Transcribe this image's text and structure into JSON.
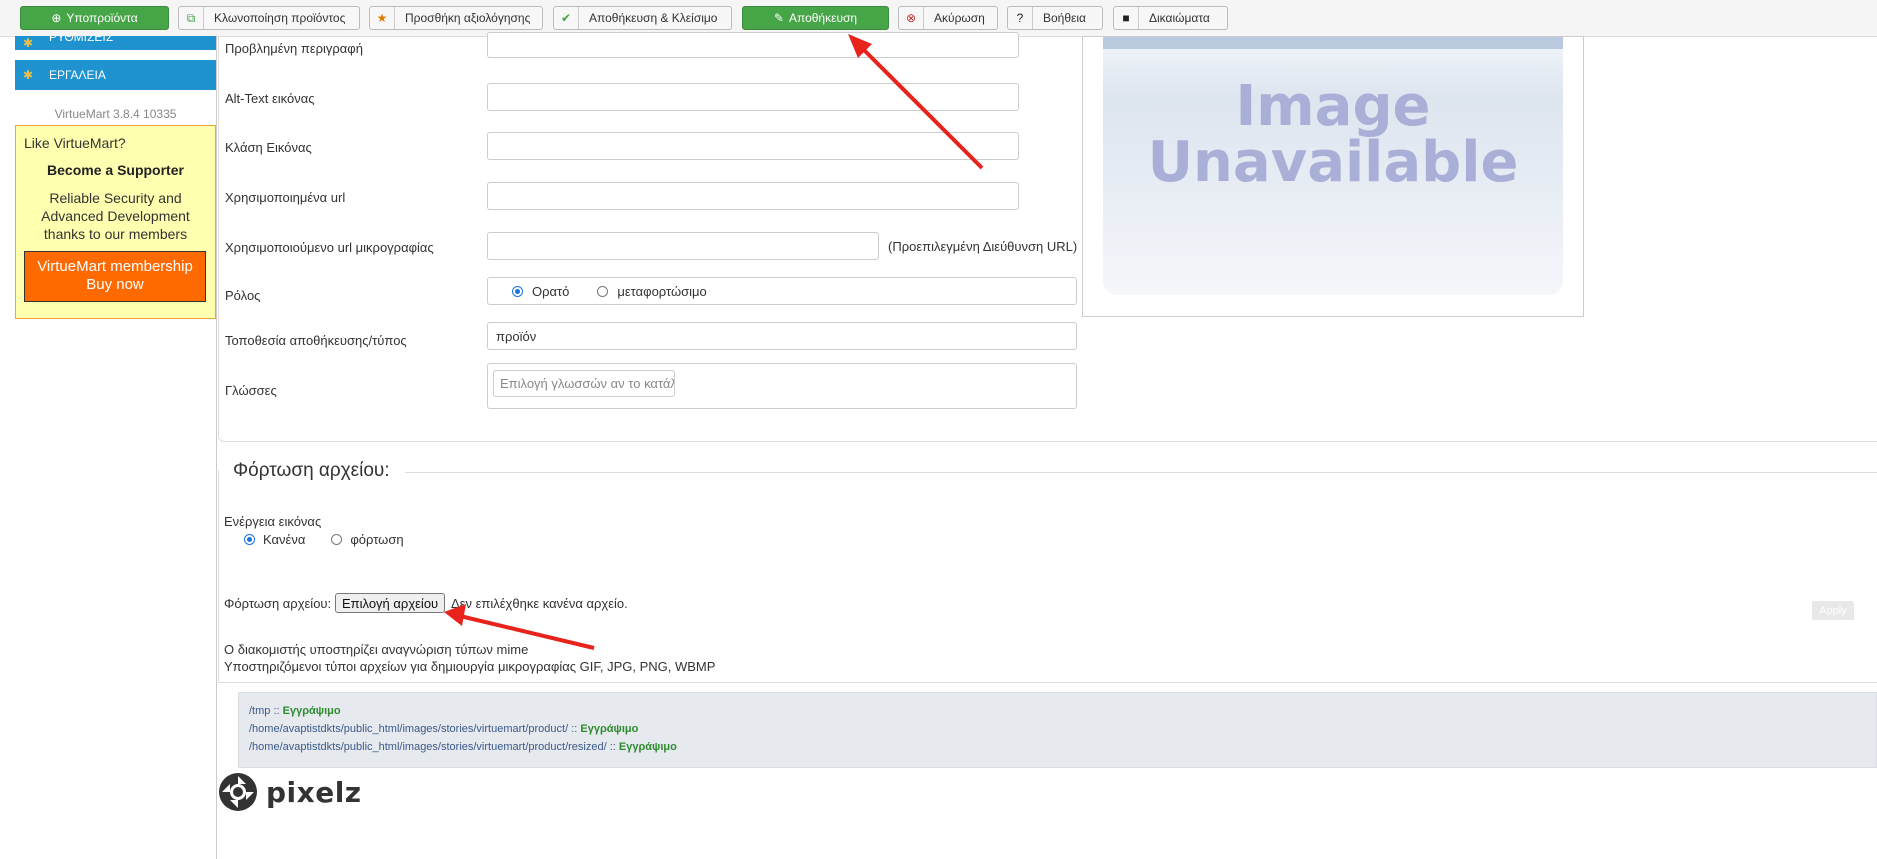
{
  "toolbar": {
    "products": "Υποπροϊόντα",
    "clone": "Κλωνοποίηση προϊόντος",
    "add_review": "Προσθήκη αξιολόγησης",
    "save_close": "Αποθήκευση & Κλείσιμο",
    "save": "Αποθήκευση",
    "cancel": "Ακύρωση",
    "help": "Βοήθεια",
    "permissions": "Δικαιώματα"
  },
  "sidebar": {
    "items": [
      {
        "label": "ΡΥΘΜΙΣΕΙΣ",
        "icon": "settings-icon"
      },
      {
        "label": "ΕΡΓΑΛΕΙΑ",
        "icon": "tools-icon"
      }
    ],
    "version": "VirtueMart 3.8.4 10335",
    "support": {
      "like": "Like VirtueMart?",
      "become": "Become a Supporter",
      "line1": "Reliable Security and",
      "line2": "Advanced Development",
      "line3": "thanks to our members",
      "button_line1": "VirtueMart membership",
      "button_line2": "Buy now"
    }
  },
  "form": {
    "default_description": "Προβλημένη περιγραφή",
    "alt_text": "Alt-Text εικόνας",
    "image_class": "Κλάση Εικόνας",
    "used_url": "Χρησιμοποιημένα url",
    "thumb_url": "Χρησιμοποιούμενο url μικρογραφίας",
    "thumb_hint": "(Προεπιλεγμένη Διεύθυνση URL)",
    "role": "Ρόλος",
    "role_options": [
      "Ορατό",
      "μεταφορτώσιμο"
    ],
    "role_selected": "Ορατό",
    "location": "Τοποθεσία αποθήκευσης/τύπος",
    "location_value": "προϊόν",
    "languages": "Γλώσσες",
    "languages_placeholder": "Επιλογή γλωσσών αν το κατάλ"
  },
  "image_preview": {
    "line1": "Image",
    "line2": "Unavailable"
  },
  "upload": {
    "legend": "Φόρτωση αρχείου:",
    "image_action": "Ενέργεια εικόνας",
    "action_options": [
      "Κανένα",
      "φόρτωση"
    ],
    "action_selected": "Κανένα",
    "file_label": "Φόρτωση αρχείου:",
    "choose_file": "Επιλογή αρχείου",
    "no_file": "Δεν επιλέχθηκε κανένα αρχείο.",
    "apply": "Apply",
    "mime_note": "Ο διακομιστής υποστηρίζει αναγνώριση τύπων mime",
    "types_note": "Υποστηριζόμενοι τύποι αρχείων για δημιουργία μικρογραφίας GIF, JPG, PNG, WBMP"
  },
  "paths": [
    {
      "path": "/tmp",
      "status": "Εγγράψιμο"
    },
    {
      "path": "/home/avaptistdkts/public_html/images/stories/virtuemart/product/",
      "status": "Εγγράψιμο"
    },
    {
      "path": "/home/avaptistdkts/public_html/images/stories/virtuemart/product/resized/",
      "status": "Εγγράψιμο"
    }
  ],
  "paths_separator": "::",
  "logo": {
    "word": "pixelz"
  },
  "colors": {
    "green": "#46a546",
    "sidebar_blue": "#1f93d0",
    "arrow_red": "#e8231c",
    "membership_orange": "#ff6a00",
    "support_yellow": "#ffffb0"
  }
}
